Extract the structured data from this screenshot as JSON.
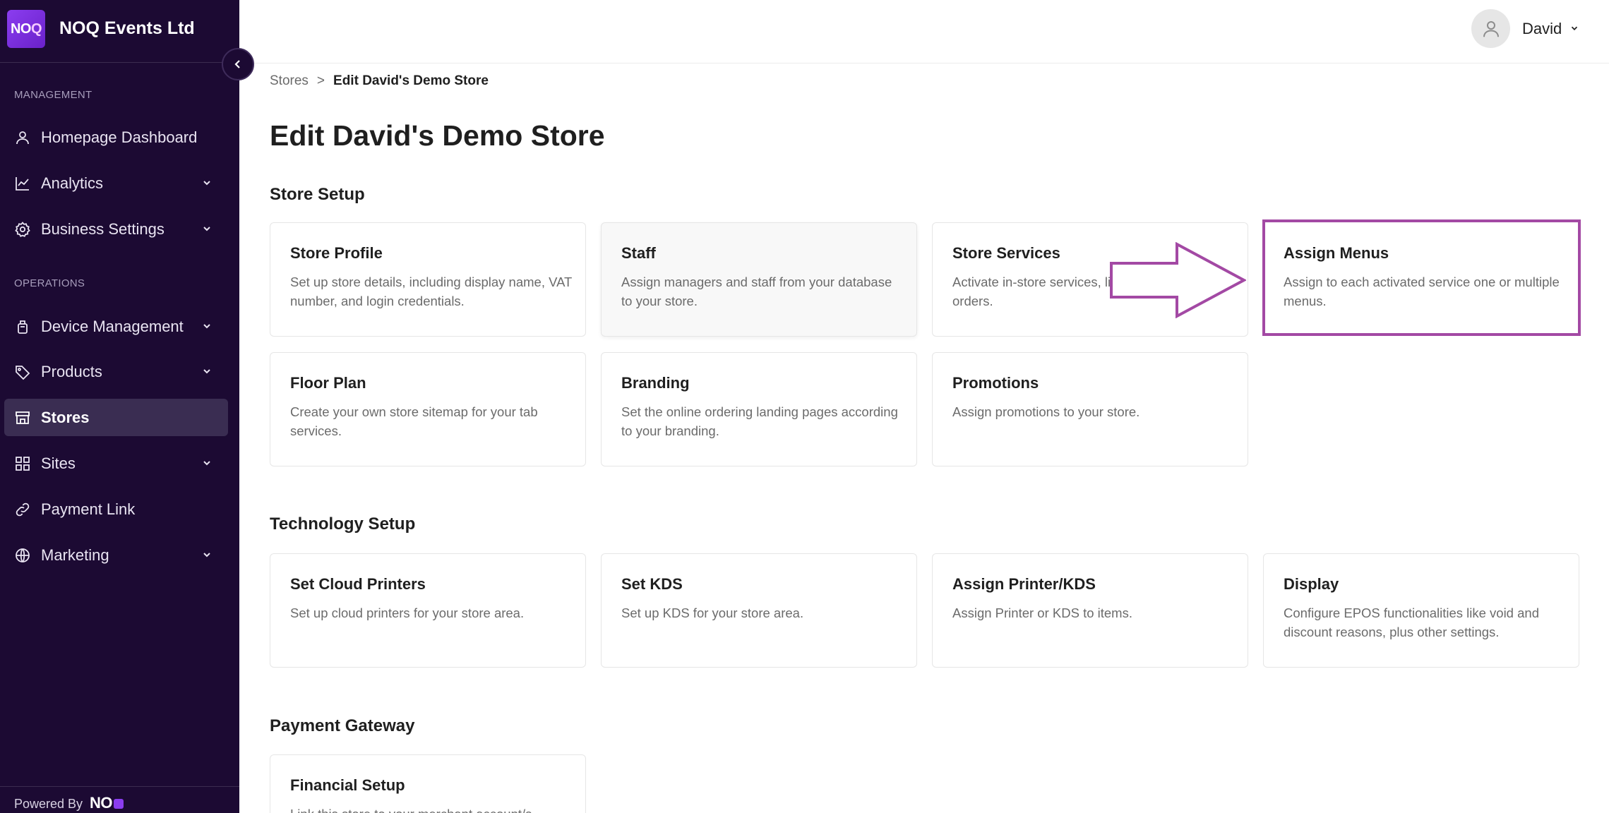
{
  "sidebar": {
    "brand": {
      "logo_main": "NO",
      "logo_accent": "Q",
      "name": "NOQ Events Ltd"
    },
    "sections": {
      "management": "MANAGEMENT",
      "operations": "OPERATIONS"
    },
    "items": [
      {
        "label": "Homepage Dashboard",
        "icon": "user-icon",
        "expandable": false
      },
      {
        "label": "Analytics",
        "icon": "chart-icon",
        "expandable": true
      },
      {
        "label": "Business Settings",
        "icon": "gear-icon",
        "expandable": true
      },
      {
        "label": "Device Management",
        "icon": "device-icon",
        "expandable": true
      },
      {
        "label": "Products",
        "icon": "tag-icon",
        "expandable": true
      },
      {
        "label": "Stores",
        "icon": "store-icon",
        "expandable": false,
        "active": true
      },
      {
        "label": "Sites",
        "icon": "grid-icon",
        "expandable": true
      },
      {
        "label": "Payment Link",
        "icon": "link-icon",
        "expandable": false
      },
      {
        "label": "Marketing",
        "icon": "globe-icon",
        "expandable": true
      }
    ],
    "powered_by": "Powered By",
    "powered_logo": "NO"
  },
  "topbar": {
    "user_name": "David"
  },
  "breadcrumb": {
    "parent": "Stores",
    "separator": ">",
    "current": "Edit David's Demo Store"
  },
  "page_title": "Edit David's Demo Store",
  "sections": {
    "store_setup": {
      "title": "Store Setup",
      "cards": [
        {
          "title": "Store Profile",
          "desc": "Set up store details, including display name, VAT number, and login credentials."
        },
        {
          "title": "Staff",
          "desc": "Assign managers and staff from your database to your store."
        },
        {
          "title": "Store Services",
          "desc": "Activate in-store services, li self-service online orders."
        },
        {
          "title": "Assign Menus",
          "desc": "Assign to each activated service one or multiple menus."
        },
        {
          "title": "Floor Plan",
          "desc": "Create your own store sitemap for your tab services."
        },
        {
          "title": "Branding",
          "desc": "Set the online ordering landing pages according to your branding."
        },
        {
          "title": "Promotions",
          "desc": "Assign promotions to your store."
        }
      ]
    },
    "technology_setup": {
      "title": "Technology Setup",
      "cards": [
        {
          "title": "Set Cloud Printers",
          "desc": "Set up cloud printers for your store area."
        },
        {
          "title": "Set KDS",
          "desc": "Set up KDS for your store area."
        },
        {
          "title": "Assign Printer/KDS",
          "desc": "Assign Printer or KDS to items."
        },
        {
          "title": "Display",
          "desc": "Configure EPOS functionalities like void and discount reasons, plus other settings."
        }
      ]
    },
    "payment_gateway": {
      "title": "Payment Gateway",
      "cards": [
        {
          "title": "Financial Setup",
          "desc": "Link this store to your merchant account/s"
        }
      ]
    }
  },
  "colors": {
    "sidebar_bg": "#1c0a33",
    "active_item_bg": "#3a2d52",
    "brand_purple": "#7b2ff0",
    "annotation": "#a349a4"
  }
}
